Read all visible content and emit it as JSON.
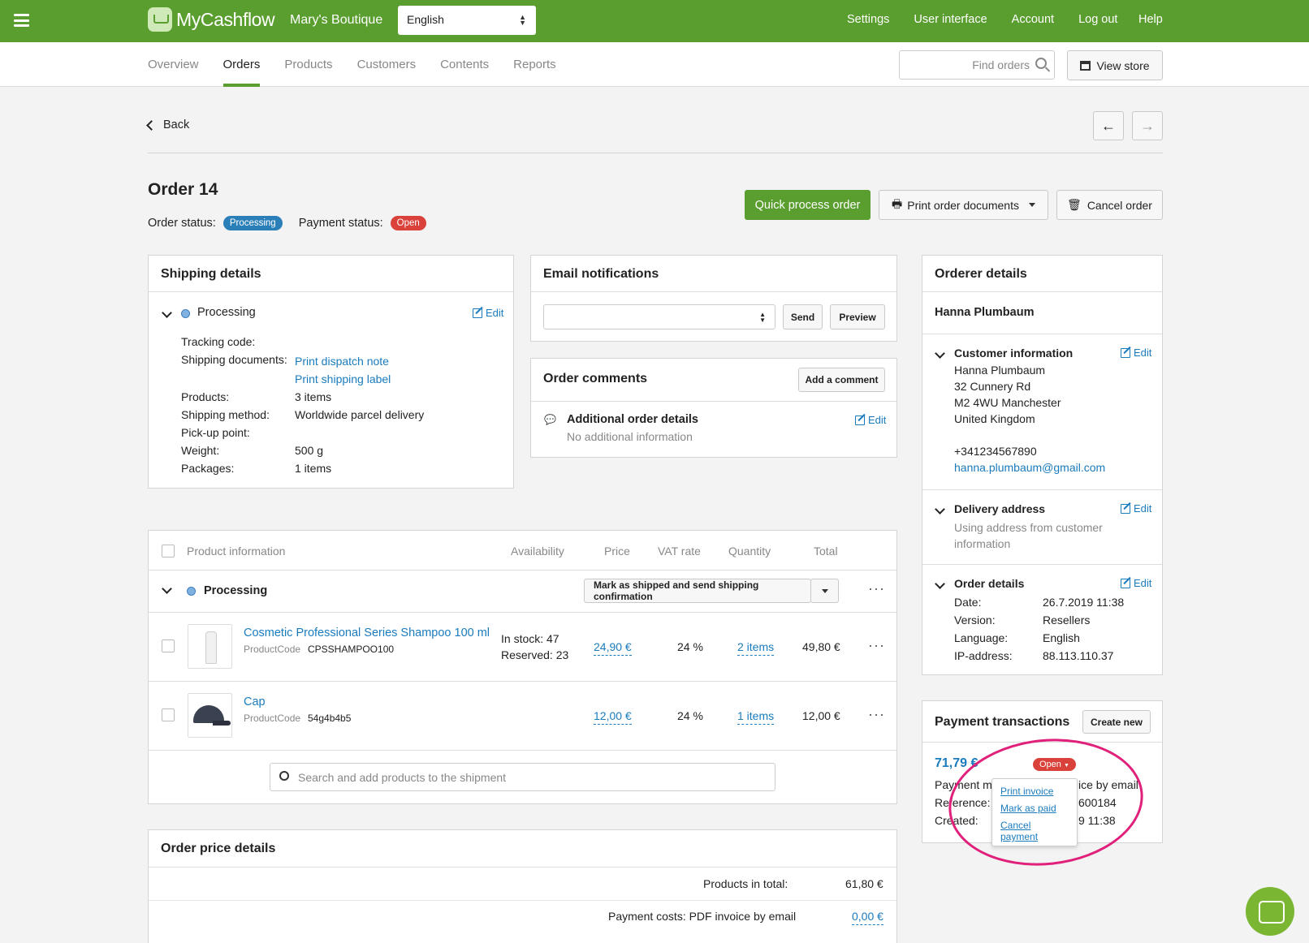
{
  "topbar": {
    "brand": "MyCashflow",
    "store": "Mary's Boutique",
    "language": "English",
    "nav": [
      "Settings",
      "User interface",
      "Account",
      "Log out"
    ],
    "help": "Help"
  },
  "tabs": [
    "Overview",
    "Orders",
    "Products",
    "Customers",
    "Contents",
    "Reports"
  ],
  "search": {
    "placeholder": "Find orders"
  },
  "view_store": "View store",
  "back": "Back",
  "order": {
    "title": "Order 14",
    "order_status_label": "Order status:",
    "order_status": "Processing",
    "payment_status_label": "Payment status:",
    "payment_status": "Open"
  },
  "actions": {
    "quick": "Quick process order",
    "print": "Print order documents",
    "cancel": "Cancel order"
  },
  "shipping": {
    "title": "Shipping details",
    "state": "Processing",
    "edit": "Edit",
    "tracking_label": "Tracking code:",
    "docs_label": "Shipping documents:",
    "doc1": "Print dispatch note",
    "doc2": "Print shipping label",
    "products_label": "Products:",
    "products": "3 items",
    "method_label": "Shipping method:",
    "method": "Worldwide parcel delivery",
    "pickup_label": "Pick-up point:",
    "weight_label": "Weight:",
    "weight": "500 g",
    "packages_label": "Packages:",
    "packages": "1 items"
  },
  "email": {
    "title": "Email notifications",
    "send": "Send",
    "preview": "Preview"
  },
  "comments": {
    "title": "Order comments",
    "add": "Add a comment",
    "item_title": "Additional order details",
    "item_text": "No additional information",
    "edit": "Edit"
  },
  "orderer": {
    "title": "Orderer details",
    "name": "Hanna Plumbaum",
    "ci_title": "Customer information",
    "ci_edit": "Edit",
    "ci_lines": [
      "Hanna Plumbaum",
      "32 Cunnery Rd",
      "M2 4WU Manchester",
      "United Kingdom"
    ],
    "phone": "+341234567890",
    "email": "hanna.plumbaum@gmail.com",
    "da_title": "Delivery address",
    "da_edit": "Edit",
    "da_text": "Using address from customer information",
    "od_title": "Order details",
    "od_edit": "Edit",
    "date_label": "Date:",
    "date": "26.7.2019 11:38",
    "version_label": "Version:",
    "version": "Resellers",
    "language_label": "Language:",
    "language": "English",
    "ip_label": "IP-address:",
    "ip": "88.113.110.37"
  },
  "table": {
    "headers": [
      "Product information",
      "Availability",
      "Price",
      "VAT rate",
      "Quantity",
      "Total"
    ],
    "group": "Processing",
    "mark_btn": "Mark as shipped and send shipping confirmation",
    "rows": [
      {
        "name": "Cosmetic Professional Series Shampoo 100 ml",
        "code_label": "ProductCode",
        "code": "CPSSHAMPOO100",
        "stock": "In stock: 47",
        "reserved": "Reserved: 23",
        "price": "24,90 €",
        "vat": "24 %",
        "qty": "2 items",
        "total": "49,80 €"
      },
      {
        "name": "Cap",
        "code_label": "ProductCode",
        "code": "54g4b4b5",
        "price": "12,00 €",
        "vat": "24 %",
        "qty": "1 items",
        "total": "12,00 €"
      }
    ],
    "search_placeholder": "Search and add products to the shipment"
  },
  "price": {
    "title": "Order price details",
    "products_label": "Products in total:",
    "products": "61,80 €",
    "payment_label": "Payment costs: PDF invoice by email",
    "payment": "0,00 €"
  },
  "payments": {
    "title": "Payment transactions",
    "create": "Create new",
    "amount": "71,79 €",
    "status": "Open",
    "method_label": "Payment m",
    "method_tail": "ice by email",
    "ref_label": "Reference:",
    "ref_tail": "600184",
    "created_label": "Created:",
    "created_tail": "9 11:38",
    "menu": [
      "Print invoice",
      "Mark as paid",
      "Cancel payment"
    ]
  },
  "colors": {
    "brand": "#5a9e2f",
    "link": "#1a7bbd",
    "danger": "#d9413a",
    "annotation": "#e0207a"
  }
}
